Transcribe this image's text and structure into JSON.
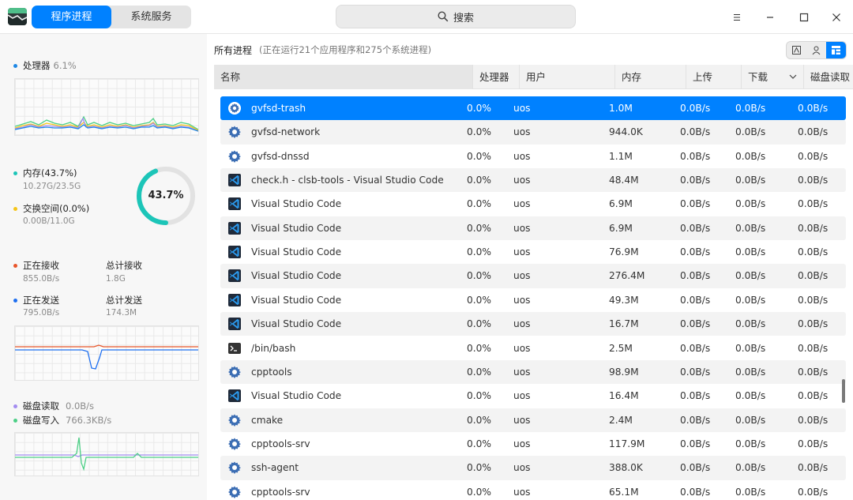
{
  "tabs": [
    {
      "label": "程序进程",
      "active": true
    },
    {
      "label": "系统服务",
      "active": false
    }
  ],
  "search": {
    "label": "搜索"
  },
  "left": {
    "cpu": {
      "label": "处理器",
      "value": "6.1%"
    },
    "memory": {
      "label": "内存(43.7%)",
      "value": "10.27G/23.5G",
      "ring_percent": "43.7%",
      "ring_fraction": 0.437
    },
    "swap": {
      "label": "交换空间(0.0%)",
      "value": "0.00B/11.0G"
    },
    "network": {
      "receiving_label": "正在接收",
      "receiving_value": "855.0B/s",
      "total_recv_label": "总计接收",
      "total_recv_value": "1.8G",
      "sending_label": "正在发送",
      "sending_value": "795.0B/s",
      "total_send_label": "总计发送",
      "total_send_value": "174.3M"
    },
    "disk": {
      "read_label": "磁盘读取",
      "read_value": "0.0B/s",
      "write_label": "磁盘写入",
      "write_value": "766.3KB/s"
    }
  },
  "summary": {
    "title": "所有进程",
    "info": "(正在运行21个应用程序和275个系统进程)"
  },
  "columns": [
    "名称",
    "处理器",
    "用户",
    "内存",
    "上传",
    "下载",
    "磁盘读取"
  ],
  "rows": [
    {
      "icon": "gear",
      "name": "gvfsd-trash",
      "cpu": "0.0%",
      "user": "uos",
      "mem": "1.0M",
      "up": "0.0B/s",
      "down": "0.0B/s",
      "disk": "0.0B/s",
      "selected": true
    },
    {
      "icon": "gear",
      "name": "gvfsd-network",
      "cpu": "0.0%",
      "user": "uos",
      "mem": "944.0K",
      "up": "0.0B/s",
      "down": "0.0B/s",
      "disk": "0.0B/s"
    },
    {
      "icon": "gear",
      "name": "gvfsd-dnssd",
      "cpu": "0.0%",
      "user": "uos",
      "mem": "1.1M",
      "up": "0.0B/s",
      "down": "0.0B/s",
      "disk": "0.0B/s"
    },
    {
      "icon": "vscode",
      "name": "check.h - clsb-tools - Visual Studio Code",
      "cpu": "0.0%",
      "user": "uos",
      "mem": "48.4M",
      "up": "0.0B/s",
      "down": "0.0B/s",
      "disk": "0.0B/s"
    },
    {
      "icon": "vscode",
      "name": "Visual Studio Code",
      "cpu": "0.0%",
      "user": "uos",
      "mem": "6.9M",
      "up": "0.0B/s",
      "down": "0.0B/s",
      "disk": "0.0B/s"
    },
    {
      "icon": "vscode",
      "name": "Visual Studio Code",
      "cpu": "0.0%",
      "user": "uos",
      "mem": "6.9M",
      "up": "0.0B/s",
      "down": "0.0B/s",
      "disk": "0.0B/s"
    },
    {
      "icon": "vscode",
      "name": "Visual Studio Code",
      "cpu": "0.0%",
      "user": "uos",
      "mem": "76.9M",
      "up": "0.0B/s",
      "down": "0.0B/s",
      "disk": "0.0B/s"
    },
    {
      "icon": "vscode",
      "name": "Visual Studio Code",
      "cpu": "0.0%",
      "user": "uos",
      "mem": "276.4M",
      "up": "0.0B/s",
      "down": "0.0B/s",
      "disk": "0.0B/s"
    },
    {
      "icon": "vscode",
      "name": "Visual Studio Code",
      "cpu": "0.0%",
      "user": "uos",
      "mem": "49.3M",
      "up": "0.0B/s",
      "down": "0.0B/s",
      "disk": "0.0B/s"
    },
    {
      "icon": "vscode",
      "name": "Visual Studio Code",
      "cpu": "0.0%",
      "user": "uos",
      "mem": "16.7M",
      "up": "0.0B/s",
      "down": "0.0B/s",
      "disk": "0.0B/s"
    },
    {
      "icon": "terminal",
      "name": "/bin/bash",
      "cpu": "0.0%",
      "user": "uos",
      "mem": "2.5M",
      "up": "0.0B/s",
      "down": "0.0B/s",
      "disk": "0.0B/s"
    },
    {
      "icon": "gear",
      "name": "cpptools",
      "cpu": "0.0%",
      "user": "uos",
      "mem": "98.9M",
      "up": "0.0B/s",
      "down": "0.0B/s",
      "disk": "0.0B/s"
    },
    {
      "icon": "vscode",
      "name": "Visual Studio Code",
      "cpu": "0.0%",
      "user": "uos",
      "mem": "16.4M",
      "up": "0.0B/s",
      "down": "0.0B/s",
      "disk": "0.0B/s"
    },
    {
      "icon": "gear",
      "name": "cmake",
      "cpu": "0.0%",
      "user": "uos",
      "mem": "2.4M",
      "up": "0.0B/s",
      "down": "0.0B/s",
      "disk": "0.0B/s"
    },
    {
      "icon": "gear",
      "name": "cpptools-srv",
      "cpu": "0.0%",
      "user": "uos",
      "mem": "117.9M",
      "up": "0.0B/s",
      "down": "0.0B/s",
      "disk": "0.0B/s"
    },
    {
      "icon": "gear",
      "name": "ssh-agent",
      "cpu": "0.0%",
      "user": "uos",
      "mem": "388.0K",
      "up": "0.0B/s",
      "down": "0.0B/s",
      "disk": "0.0B/s"
    },
    {
      "icon": "gear",
      "name": "cpptools-srv",
      "cpu": "0.0%",
      "user": "uos",
      "mem": "65.1M",
      "up": "0.0B/s",
      "down": "0.0B/s",
      "disk": "0.0B/s"
    }
  ],
  "colors": {
    "accent": "#0081ff",
    "cpu_dot": "#1e88e5",
    "memory_dot": "#1cc5b8",
    "swap_dot": "#f5c518",
    "recv_dot": "#e8552a",
    "send_dot": "#1e6ff0",
    "disk_read_dot": "#a38cf0",
    "disk_write_dot": "#4ccf86"
  }
}
